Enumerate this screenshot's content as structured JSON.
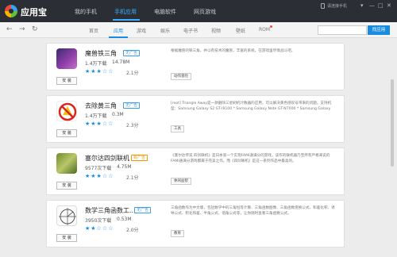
{
  "app": {
    "title": "应用宝",
    "tabs": [
      "我的手机",
      "手机应用",
      "电脑软件",
      "网页游戏"
    ],
    "phone_status": "请连接手机",
    "window_controls": [
      "▾",
      "—",
      "□",
      "✕"
    ]
  },
  "toolbar": {
    "back": "←",
    "forward": "→",
    "refresh": "↻",
    "tabs": [
      "首页",
      "应用",
      "游戏",
      "娱乐",
      "电子书",
      "视频",
      "壁纸",
      "ROM"
    ],
    "active_tab": "应用",
    "search_placeholder": "",
    "search_button": "找应用"
  },
  "apps": [
    {
      "name": "魔兽铁三角",
      "badge": "无广告",
      "downloads": "1.4万下载",
      "size": "14.78M",
      "stars": "★★★☆☆",
      "score": "2.1分",
      "install_label": "安 装",
      "description": "根据魔兽的铁三角，并以有技术的魔兽，丰富的系统，在游戏里尽情战斗吧。",
      "tag": "动作冒险"
    },
    {
      "name": "去除黄三角",
      "badge": "无广告",
      "downloads": "1.4万下载",
      "size": "0.3M",
      "stars": "★★★☆☆",
      "score": "2.3分",
      "install_label": "安 装",
      "description": "[root] Triangle Away是一款删除三星刷机计数器的应用，可以解决黄色感叹号带来的问题。支持机型：Samsung Galaxy S2 GT-I9100 * Samsung Galaxy Note GT-N7000 * Samsung Galaxy",
      "tag": "工具"
    },
    {
      "name": "塞尔达四剑联机",
      "badge": "有广告",
      "downloads": "9577次下载",
      "size": "4.75M",
      "stars": "★★★☆☆",
      "score": "2.1分",
      "install_label": "安 装",
      "description": "《塞尔达传说 四剑联机》是日本第一个实现FAMI通满分的游戏，该作的联机器乃至所有严格来说的FAMI通满分游戏都属于完美之作。而《四剑联机》是这一系列作品中最高的。",
      "tag": "休闲益智"
    },
    {
      "name": "数学三角函数工...",
      "badge": "无广告",
      "downloads": "3950次下载",
      "size": "0.53M",
      "stars": "★★☆☆☆",
      "score": "2.0分",
      "install_label": "安 装",
      "description": "三角函数作为中文版，包括数学中的三角恒等计算、三角函数图像、三角函数变换公式、和差化积、诱导公式、积化和差、半角公式、倍角公式等，让你随时查看三角函数公式。",
      "tag": "教育"
    }
  ]
}
